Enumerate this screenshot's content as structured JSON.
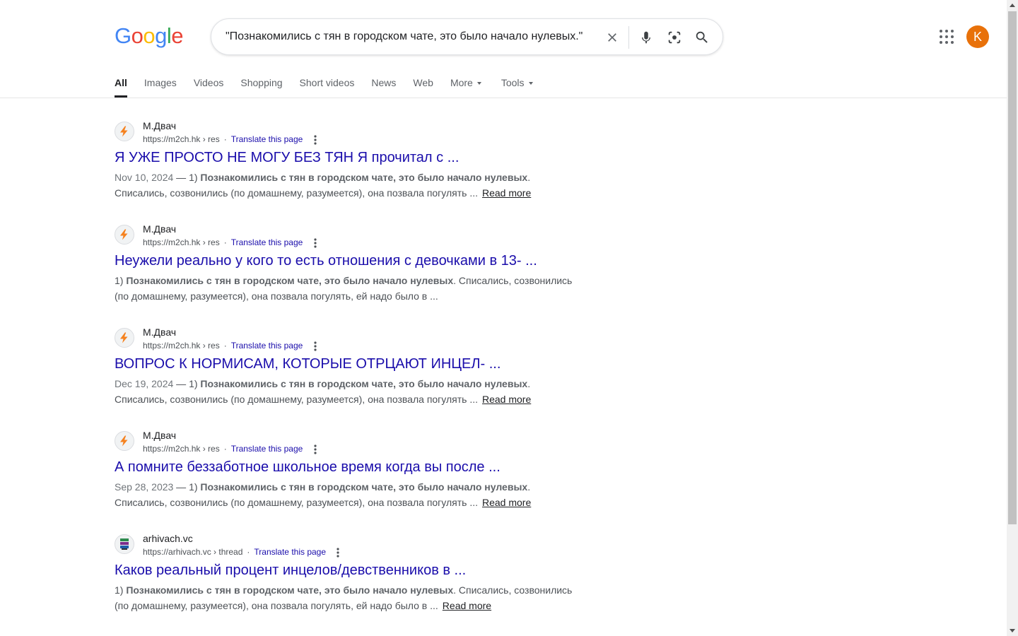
{
  "search": {
    "query": "\"Познакомились с тян в городском чате, это было начало нулевых.\""
  },
  "logo": {
    "letters": [
      "G",
      "o",
      "o",
      "g",
      "l",
      "e"
    ]
  },
  "colors": {
    "blue": "#4285f4",
    "red": "#ea4335",
    "yellow": "#fbbc05",
    "green": "#34a853",
    "link": "#1a0dab",
    "avatar": "#e8710a"
  },
  "account": {
    "initial": "K"
  },
  "tabs": [
    {
      "label": "All",
      "active": true
    },
    {
      "label": "Images"
    },
    {
      "label": "Videos"
    },
    {
      "label": "Shopping"
    },
    {
      "label": "Short videos"
    },
    {
      "label": "News"
    },
    {
      "label": "Web"
    },
    {
      "label": "More",
      "dropdown": true
    },
    {
      "label": "Tools",
      "dropdown": true
    }
  ],
  "results": [
    {
      "site": "М.Двач",
      "url": "https://m2ch.hk › res",
      "translate": "Translate this page",
      "title": "Я УЖЕ ПРОСТО НЕ МОГУ БЕЗ ТЯН Я прочитал с ...",
      "date": "Nov 10, 2024",
      "snippet_prefix": "1) ",
      "snippet_bold": "Познакомились с тян в городском чате, это было начало нулевых",
      "snippet_rest": ". Списались, созвонились (по домашнему, разумеется), она позвала погулять ...",
      "read_more": "Read more",
      "favicon": "lightning"
    },
    {
      "site": "М.Двач",
      "url": "https://m2ch.hk › res",
      "translate": "Translate this page",
      "title": "Неужели реально у кого то есть отношения с девочками в 13- ...",
      "date": "",
      "snippet_prefix": "1) ",
      "snippet_bold": "Познакомились с тян в городском чате, это было начало нулевых",
      "snippet_rest": ". Списались, созвонились (по домашнему, разумеется), она позвала погулять, ей надо было в ...",
      "read_more": "",
      "favicon": "lightning"
    },
    {
      "site": "М.Двач",
      "url": "https://m2ch.hk › res",
      "translate": "Translate this page",
      "title": "ВОПРОС К НОРМИСАМ, КОТОРЫЕ ОТРЦАЮТ ИНЦЕЛ- ...",
      "date": "Dec 19, 2024",
      "snippet_prefix": "1) ",
      "snippet_bold": "Познакомились с тян в городском чате, это было начало нулевых",
      "snippet_rest": ". Списались, созвонились (по домашнему, разумеется), она позвала погулять ...",
      "read_more": "Read more",
      "favicon": "lightning"
    },
    {
      "site": "М.Двач",
      "url": "https://m2ch.hk › res",
      "translate": "Translate this page",
      "title": "А помните беззаботное школьное время когда вы после ...",
      "date": "Sep 28, 2023",
      "snippet_prefix": "1) ",
      "snippet_bold": "Познакомились с тян в городском чате, это было начало нулевых",
      "snippet_rest": ". Списались, созвонились (по домашнему, разумеется), она позвала погулять ...",
      "read_more": "Read more",
      "favicon": "lightning"
    },
    {
      "site": "arhivach.vc",
      "url": "https://arhivach.vc › thread",
      "translate": "Translate this page",
      "title": "Каков реальный процент инцелов/девственников в ...",
      "date": "",
      "snippet_prefix": "1) ",
      "snippet_bold": "Познакомились с тян в городском чате, это было начало нулевых",
      "snippet_rest": ". Списались, созвонились (по домашнему, разумеется), она позвала погулять, ей надо было в ...",
      "read_more": "Read more",
      "favicon": "archive"
    }
  ]
}
